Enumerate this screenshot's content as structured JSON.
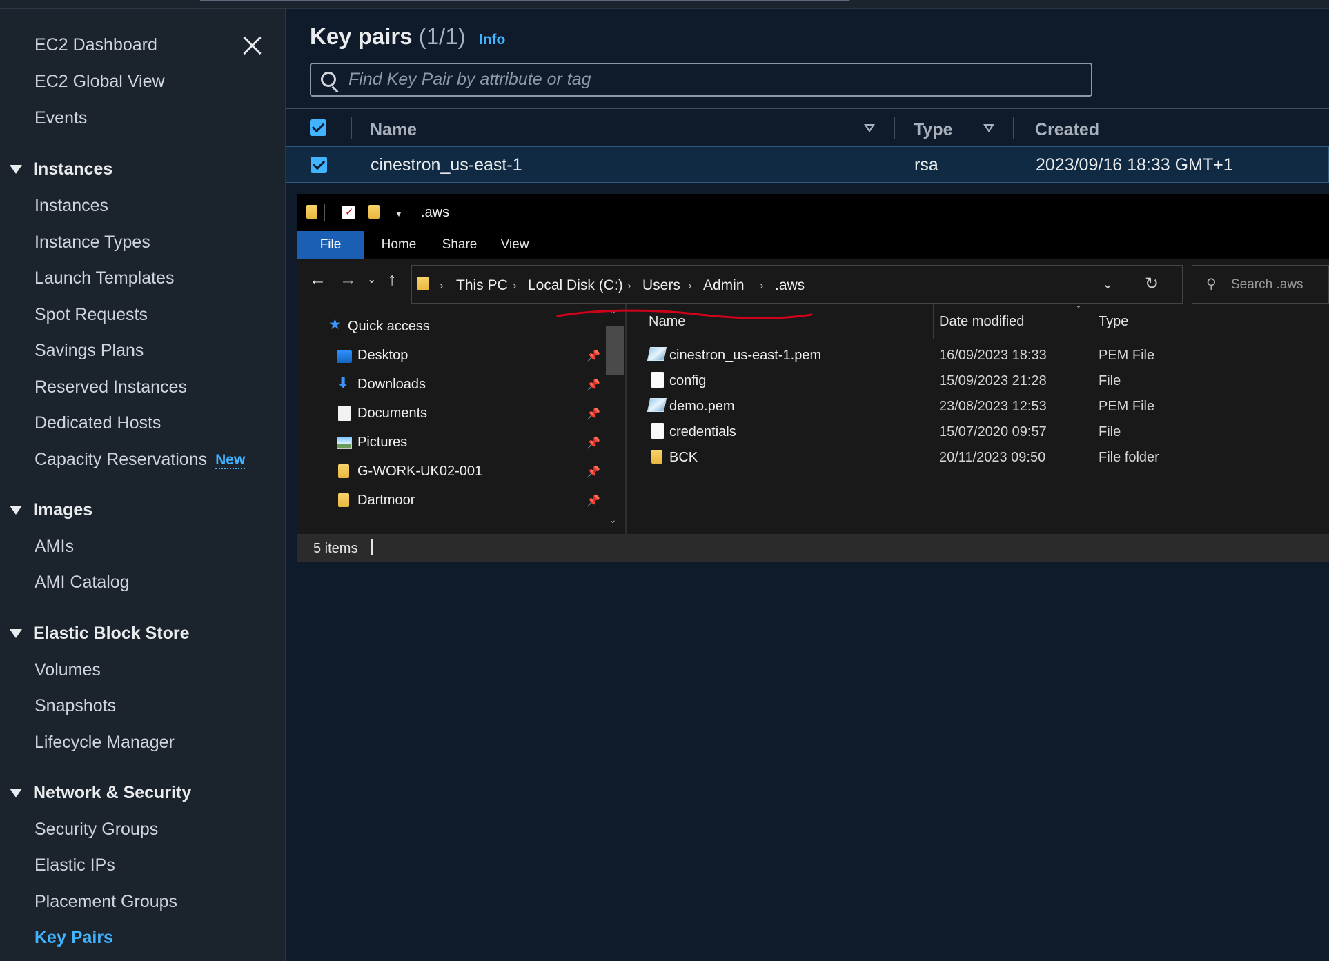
{
  "sidebar": {
    "top_items": [
      "EC2 Dashboard",
      "EC2 Global View",
      "Events"
    ],
    "sections": [
      {
        "title": "Instances",
        "items": [
          "Instances",
          "Instance Types",
          "Launch Templates",
          "Spot Requests",
          "Savings Plans",
          "Reserved Instances",
          "Dedicated Hosts",
          "Capacity Reservations"
        ]
      },
      {
        "title": "Images",
        "items": [
          "AMIs",
          "AMI Catalog"
        ]
      },
      {
        "title": "Elastic Block Store",
        "items": [
          "Volumes",
          "Snapshots",
          "Lifecycle Manager"
        ]
      },
      {
        "title": "Network & Security",
        "items": [
          "Security Groups",
          "Elastic IPs",
          "Placement Groups",
          "Key Pairs"
        ]
      }
    ],
    "new_badge": "New",
    "active_item": "Key Pairs"
  },
  "key_pairs": {
    "title": "Key pairs",
    "count": "(1/1)",
    "info_label": "Info",
    "search_placeholder": "Find Key Pair by attribute or tag",
    "columns": [
      "Name",
      "Type",
      "Created"
    ],
    "rows": [
      {
        "name": "cinestron_us-east-1",
        "type": "rsa",
        "created": "2023/09/16 18:33 GMT+1"
      }
    ]
  },
  "explorer": {
    "window_title": ".aws",
    "ribbon_tabs": [
      "File",
      "Home",
      "Share",
      "View"
    ],
    "breadcrumb": [
      "This PC",
      "Local Disk (C:)",
      "Users",
      "Admin",
      ".aws"
    ],
    "search_placeholder": "Search .aws",
    "quick_access_label": "Quick access",
    "quick_access": [
      "Desktop",
      "Downloads",
      "Documents",
      "Pictures",
      "G-WORK-UK02-001",
      "Dartmoor"
    ],
    "columns": [
      "Name",
      "Date modified",
      "Type"
    ],
    "files": [
      {
        "name": "cinestron_us-east-1.pem",
        "modified": "16/09/2023 18:33",
        "type": "PEM File",
        "icon": "pem-certificate-icon"
      },
      {
        "name": "config",
        "modified": "15/09/2023 21:28",
        "type": "File",
        "icon": "file-icon"
      },
      {
        "name": "demo.pem",
        "modified": "23/08/2023 12:53",
        "type": "PEM File",
        "icon": "pem-certificate-icon"
      },
      {
        "name": "credentials",
        "modified": "15/07/2020 09:57",
        "type": "File",
        "icon": "file-icon"
      },
      {
        "name": "BCK",
        "modified": "20/11/2023 09:50",
        "type": "File folder",
        "icon": "folder-icon"
      }
    ],
    "status_text": "5 items",
    "annotation_color": "#d0021b"
  },
  "colors": {
    "aws_link": "#42b4ff",
    "explorer_file_tab": "#1a5fb4"
  }
}
